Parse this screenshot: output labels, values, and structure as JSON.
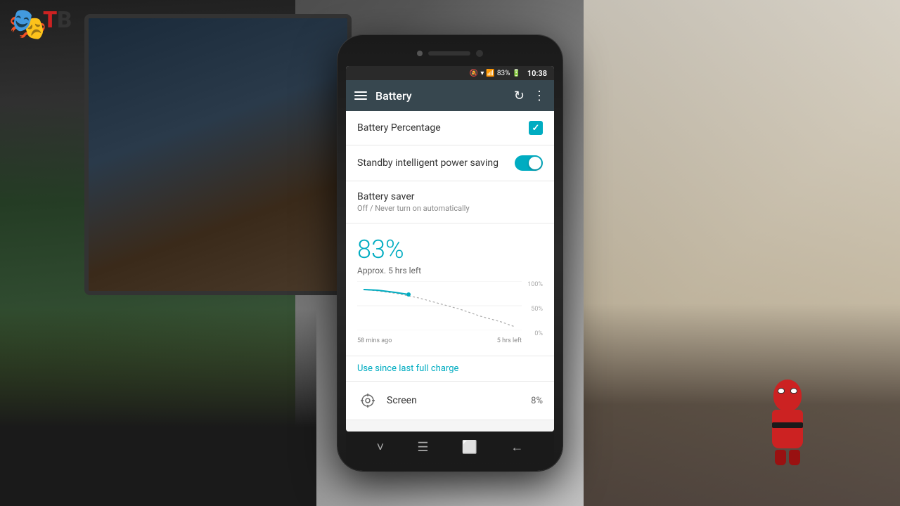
{
  "logo": {
    "letter_t": "T",
    "letter_b": "B"
  },
  "status_bar": {
    "battery_percent": "83%",
    "time": "10:38",
    "icons": [
      "silent",
      "wifi",
      "signal",
      "battery"
    ]
  },
  "app_bar": {
    "title": "Battery",
    "menu_icon": "≡",
    "refresh_icon": "↻",
    "more_icon": "⋮"
  },
  "settings": {
    "battery_percentage_label": "Battery Percentage",
    "battery_percentage_checked": true,
    "standby_label": "Standby intelligent power saving",
    "standby_enabled": true,
    "battery_saver_label": "Battery saver",
    "battery_saver_sub": "Off / Never turn on automatically",
    "battery_level": "83%",
    "time_left": "Approx. 5 hrs left",
    "chart_labels": {
      "p100": "100%",
      "p50": "50%",
      "p0": "0%",
      "time_ago": "58 mins ago",
      "time_left": "5 hrs left"
    },
    "use_since_label": "Use since last full charge",
    "screen_label": "Screen",
    "screen_percent": "8%"
  },
  "nav_bar": {
    "down_icon": "˅",
    "menu_icon": "☰",
    "square_icon": "□",
    "back_icon": "←"
  }
}
